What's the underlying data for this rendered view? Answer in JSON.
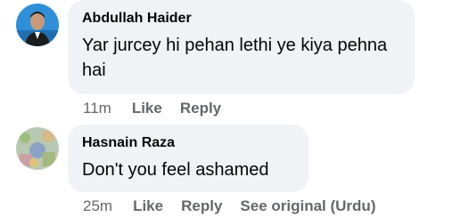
{
  "comments": [
    {
      "author": "Abdullah Haider",
      "text": "Yar jurcey hi pehan lethi ye kiya pehna hai",
      "time": "11m",
      "like_label": "Like",
      "reply_label": "Reply"
    },
    {
      "author": "Hasnain Raza",
      "text": "Don't you feel ashamed",
      "time": "25m",
      "like_label": "Like",
      "reply_label": "Reply",
      "see_original_label": "See original (Urdu)"
    }
  ],
  "colors": {
    "bubble": "#f0f2f5",
    "secondary_text": "#65676b",
    "primary_text": "#050505"
  },
  "icons": [
    "avatar-abdullah-haider",
    "avatar-hasnain-raza"
  ]
}
